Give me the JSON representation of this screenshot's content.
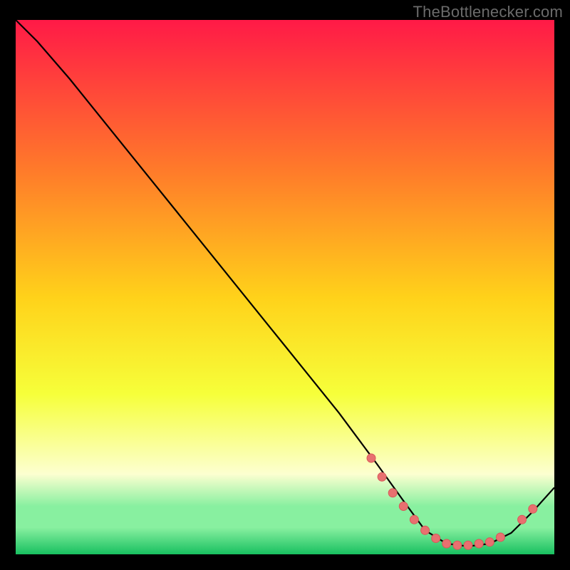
{
  "attribution": "TheBottlenecker.com",
  "colors": {
    "background_black": "#000000",
    "gradient_top": "#ff1a47",
    "gradient_mid_upper": "#ff7a2a",
    "gradient_mid": "#ffd21a",
    "gradient_mid_lower": "#f6ff3a",
    "gradient_low_yellow": "#fcffd0",
    "gradient_green_light": "#88f0a0",
    "gradient_green": "#18c060",
    "curve_stroke": "#000000",
    "dot_fill": "#e87070",
    "dot_stroke": "#d85858",
    "attribution_text": "#6b6b6b"
  },
  "chart_data": {
    "type": "line",
    "title": "",
    "xlabel": "",
    "ylabel": "",
    "xlim": [
      0,
      100
    ],
    "ylim": [
      0,
      100
    ],
    "series": [
      {
        "name": "main-curve",
        "x": [
          0,
          4,
          10,
          20,
          30,
          40,
          50,
          60,
          67,
          72,
          76,
          80,
          84,
          88,
          92,
          96,
          100
        ],
        "values": [
          100,
          96,
          89,
          76.5,
          64,
          51.5,
          39,
          26.5,
          17,
          10,
          4.5,
          2,
          1.5,
          2,
          4,
          8,
          12.5
        ]
      }
    ],
    "markers": {
      "name": "highlight-dots",
      "x": [
        66,
        68,
        70,
        72,
        74,
        76,
        78,
        80,
        82,
        84,
        86,
        88,
        90,
        94,
        96
      ],
      "values": [
        18,
        14.5,
        11.5,
        9,
        6.5,
        4.5,
        3,
        2,
        1.7,
        1.7,
        2,
        2.3,
        3.2,
        6.5,
        8.5
      ]
    }
  }
}
